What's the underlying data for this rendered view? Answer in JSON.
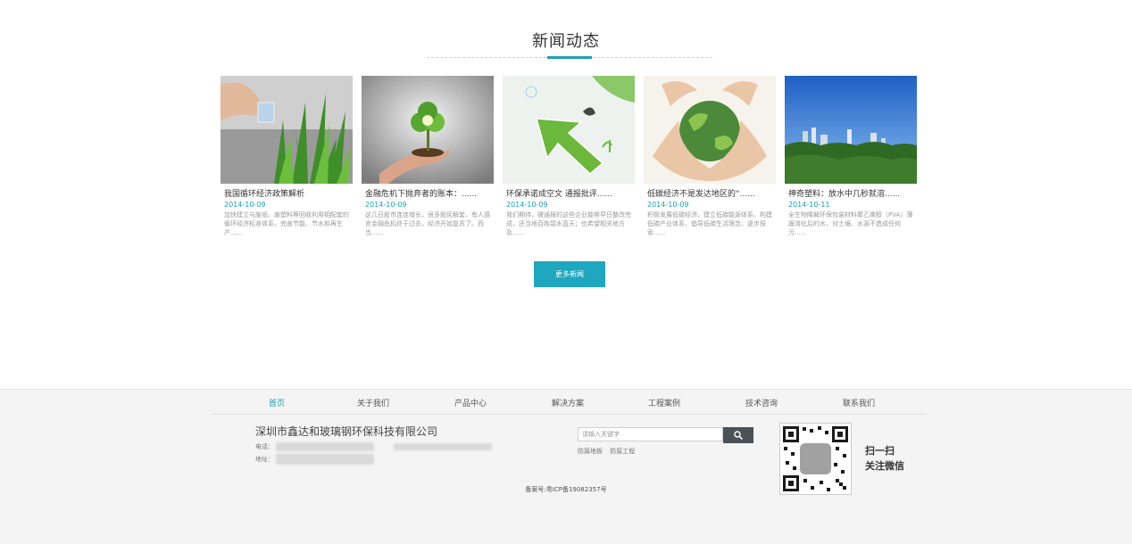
{
  "section": {
    "title": "新闻动态"
  },
  "news": [
    {
      "title": "我国循环经济政策解析",
      "date": "2014-10-09",
      "desc": "加快建立与废纸、废塑料等回收利用相配套的循环经济标准体系，完善节能、节水和再生产......"
    },
    {
      "title": "金融危机下抛弃者的账本：......",
      "date": "2014-10-09",
      "desc": "这几日股市连连增长，很多股民解套，有人感言金融危机终于过去，经济开始复苏了。而当......"
    },
    {
      "title": "环保承诺成空文 通报批评......",
      "date": "2014-10-09",
      "desc": "我们期待，被通报的这些企业能够早日整改完成，还当地百姓碧水蓝天；也希望相关地方及......"
    },
    {
      "title": "低碳经济不是发达地区的“......",
      "date": "2014-10-09",
      "desc": "积极发展低碳经济，建立低碳能源体系，构建低碳产业体系，倡导低碳生活理念，逐步探索......"
    },
    {
      "title": "神奇塑料：放水中几秒就溶......",
      "date": "2014-10-11",
      "desc": "全生物降解环保包装材料聚乙烯醇（PVA）薄膜溶化后的水，对土壤、水源不造成任何污......"
    }
  ],
  "more_button": "更多新闻",
  "footer": {
    "nav": [
      "首页",
      "关于我们",
      "产品中心",
      "解决方案",
      "工程案例",
      "技术咨询",
      "联系我们"
    ],
    "active_nav": "首页",
    "company": "深圳市鑫达和玻璃钢环保科技有限公司",
    "phone_label": "电话：",
    "address_label": "地址：",
    "search_placeholder": "请输入关键字",
    "hotwords": [
      "防腐地板",
      "防腐工程"
    ],
    "icp": "备案号:粤ICP备19082357号",
    "qr_line1": "扫一扫",
    "qr_line2": "关注微信"
  },
  "colors": {
    "accent": "#1d9fb4",
    "button": "#1ea7bf",
    "search_button": "#4b5257"
  }
}
